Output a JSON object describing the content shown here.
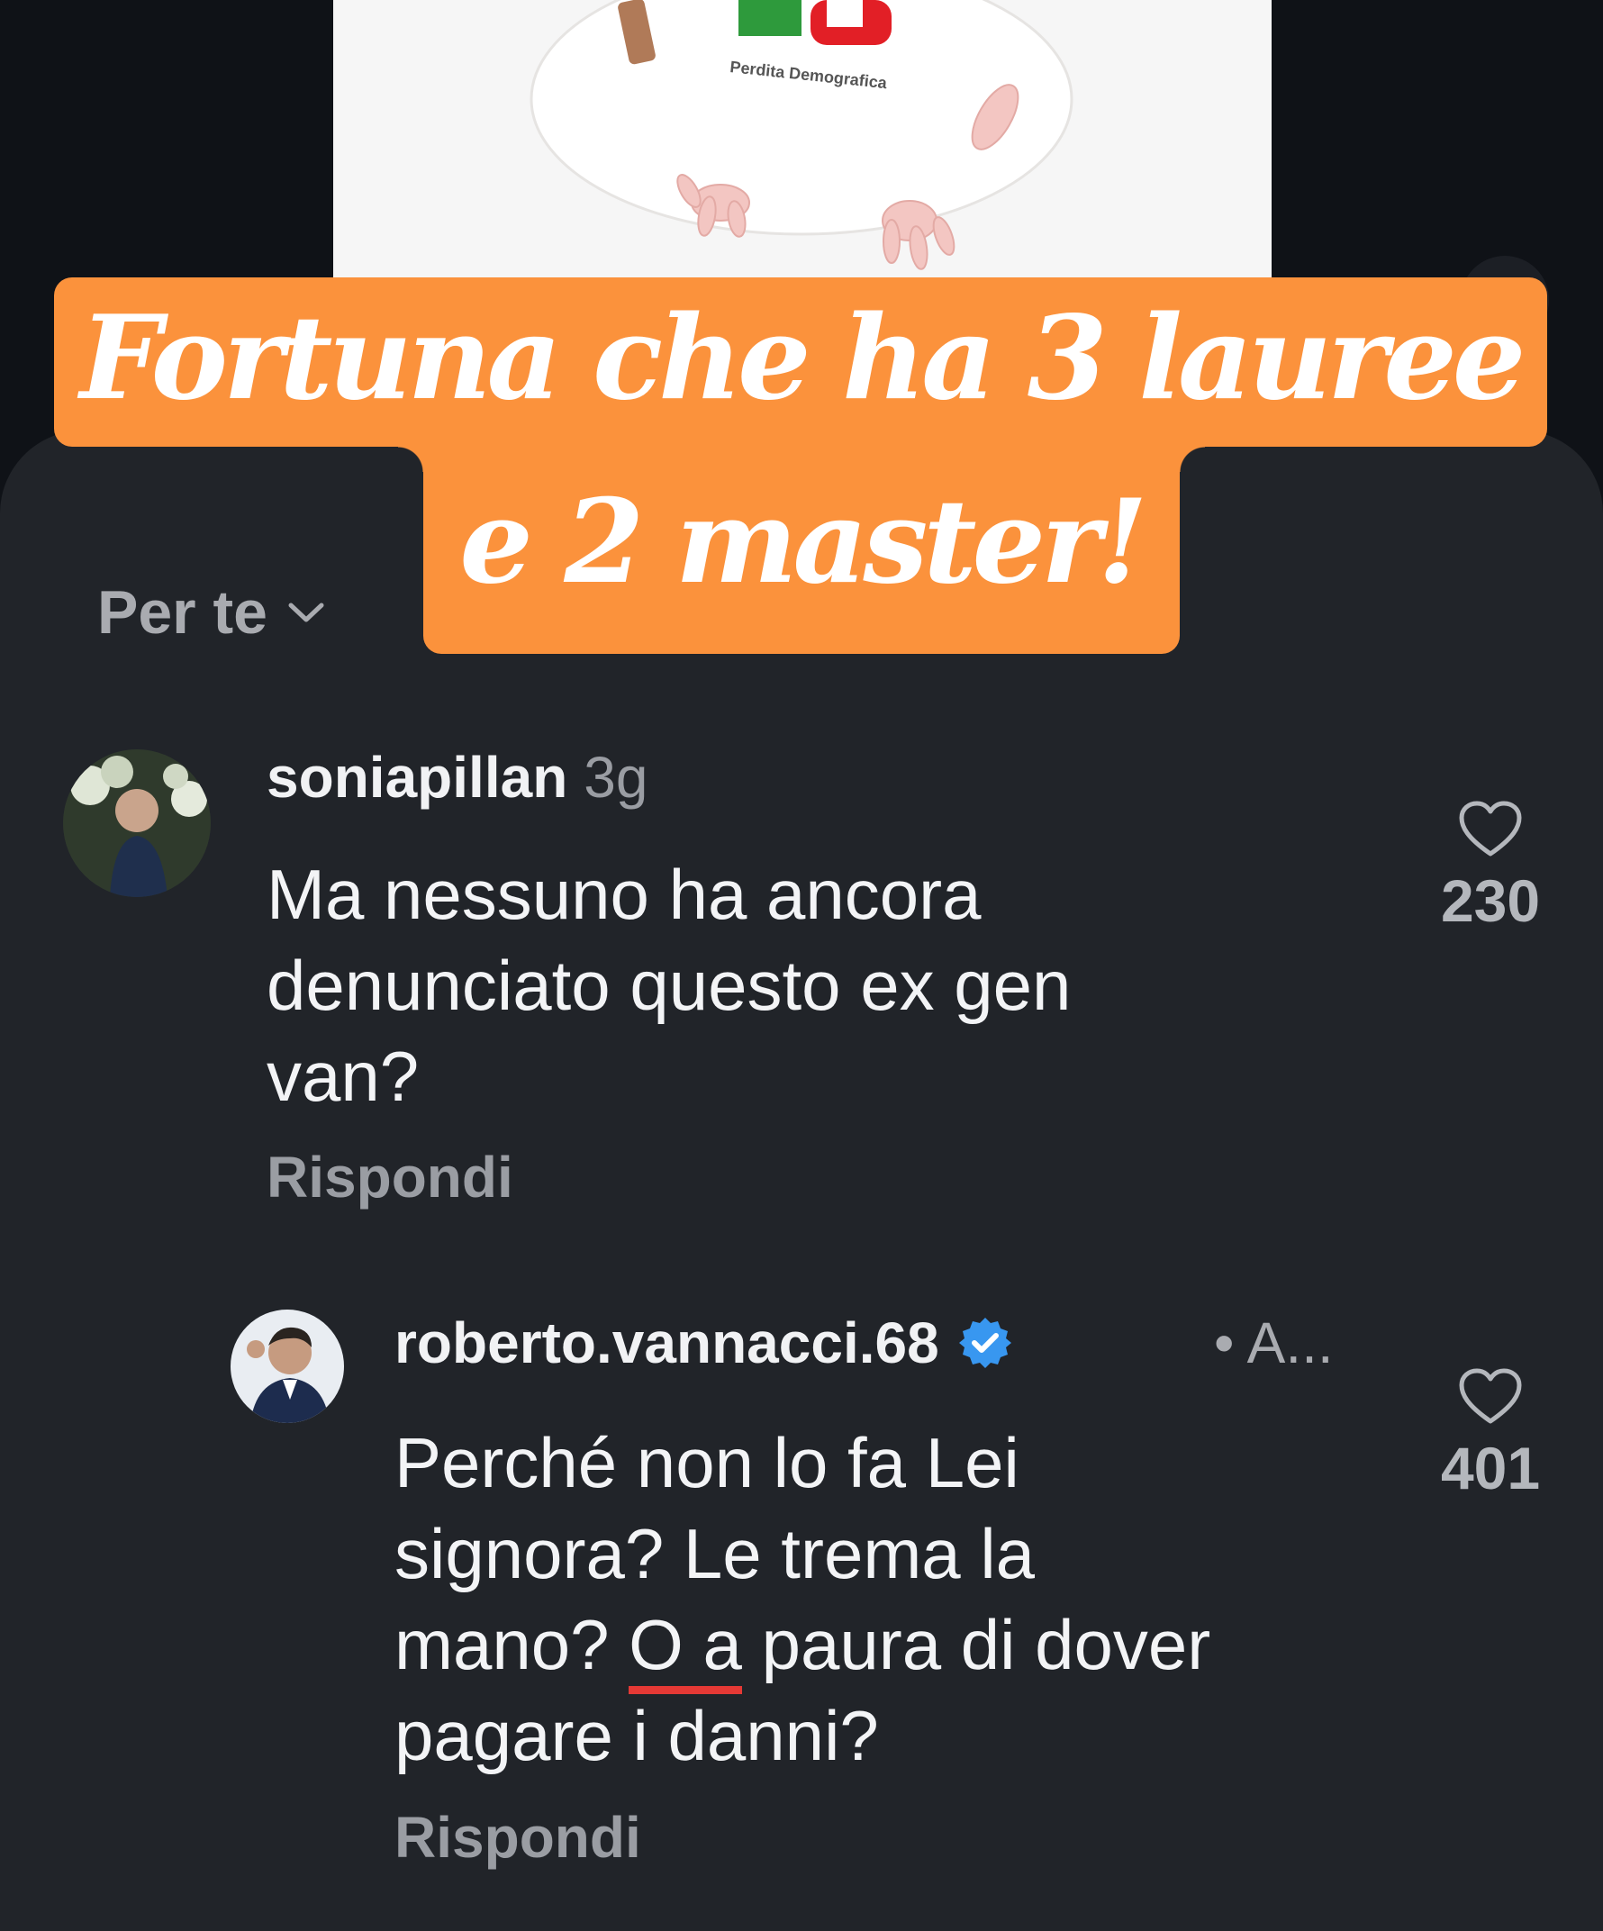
{
  "caption": {
    "line1": "Fortuna che ha 3 lauree",
    "line2": "e 2 master!"
  },
  "media": {
    "logo_text": "Perdita Demografica"
  },
  "sort": {
    "label": "Per te"
  },
  "comments": [
    {
      "username": "soniapillan",
      "time": "3g",
      "text_lines": [
        "Ma nessuno ha ancora",
        "denunciato questo ex gen",
        "van?"
      ],
      "reply_label": "Rispondi",
      "likes": "230"
    }
  ],
  "replies": [
    {
      "username": "roberto.vannacci.68",
      "verified": true,
      "meta": "• A...",
      "text_lines": [
        "Perché non lo fa Lei",
        "signora? Le trema la",
        "mano? ",
        "O a",
        " paura di dover",
        "pagare i danni?"
      ],
      "reply_label": "Rispondi",
      "likes": "401"
    }
  ],
  "colors": {
    "caption_bg": "#fb923c",
    "sheet_bg": "#212429",
    "page_bg": "#0f1217",
    "verified": "#3897f0",
    "spellcheck": "#e53935"
  },
  "icons": [
    "chevron-down-icon",
    "heart-icon",
    "verified-badge-icon"
  ]
}
